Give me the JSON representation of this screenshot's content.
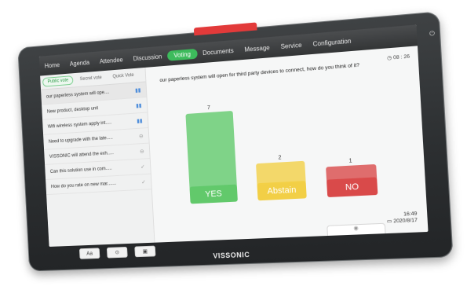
{
  "nav": {
    "items": [
      "Home",
      "Agenda",
      "Attendee",
      "Discussion",
      "Voting",
      "Documents",
      "Message",
      "Service",
      "Configuration"
    ],
    "active": "Voting"
  },
  "vote_tabs": [
    "Public vote",
    "Secret vote",
    "Quick Vote"
  ],
  "vote_list": [
    {
      "label": "our paperless system will ope....",
      "icon": "chart-icon"
    },
    {
      "label": "New product, desktop unit",
      "icon": "chart-icon"
    },
    {
      "label": "Wifi wireless system apply int.....",
      "icon": "chart-icon"
    },
    {
      "label": "Need to upgrade with the late.....",
      "icon": "minus-circle-icon"
    },
    {
      "label": "VISSONIC will attend the exh.....",
      "icon": "minus-circle-icon"
    },
    {
      "label": "Can this solution use in com.....",
      "icon": "check-icon"
    },
    {
      "label": "How do you rate on new mar.......",
      "icon": "check-icon"
    }
  ],
  "question": "our paperless system will open for third party devices to connect, how do you think of it?",
  "timer": "08 : 26",
  "chart_data": {
    "type": "bar",
    "categories": [
      "YES",
      "Abstain",
      "NO"
    ],
    "values": [
      7,
      2,
      1
    ],
    "colors": [
      "#62c96b",
      "#f2cf46",
      "#d94a4a"
    ],
    "ylim": [
      0,
      7
    ]
  },
  "clock": {
    "time": "16:49",
    "date": "2020/8/17"
  },
  "bottom_buttons": [
    "Aa",
    "",
    "",
    ""
  ],
  "brand": "VISSONIC"
}
